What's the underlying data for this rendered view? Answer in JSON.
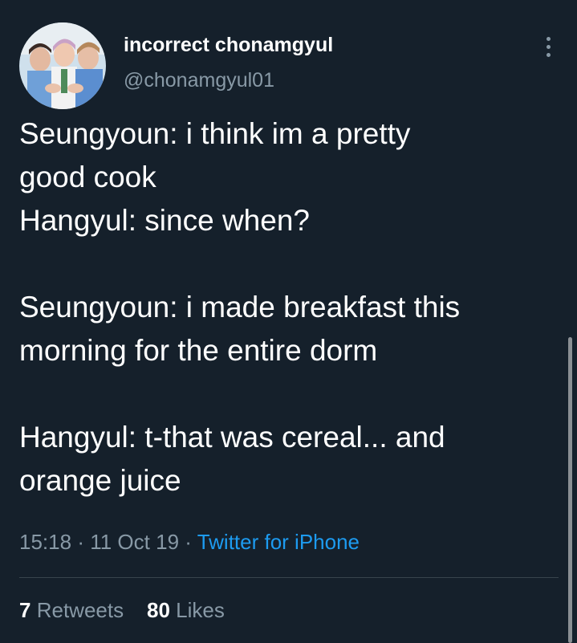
{
  "author": {
    "display_name": "incorrect chonamgyul",
    "handle": "@chonamgyul01"
  },
  "tweet": {
    "lines": [
      "Seungyoun: i think im a pretty",
      "good cook",
      "Hangyul: since when?",
      "",
      "Seungyoun: i made breakfast this",
      "morning for the entire dorm",
      "",
      "Hangyul: t-that was cereal... and",
      "orange juice"
    ],
    "time": "15:18",
    "date": "11 Oct 19",
    "separator": "·",
    "source": "Twitter for iPhone"
  },
  "stats": {
    "retweets_count": "7",
    "retweets_label": "Retweets",
    "likes_count": "80",
    "likes_label": "Likes"
  },
  "icons": {
    "more": "more-vertical-icon"
  },
  "colors": {
    "background": "#15202b",
    "text": "#ffffff",
    "secondary": "#8899a6",
    "link": "#1d9bf0",
    "divider": "#38444d"
  }
}
